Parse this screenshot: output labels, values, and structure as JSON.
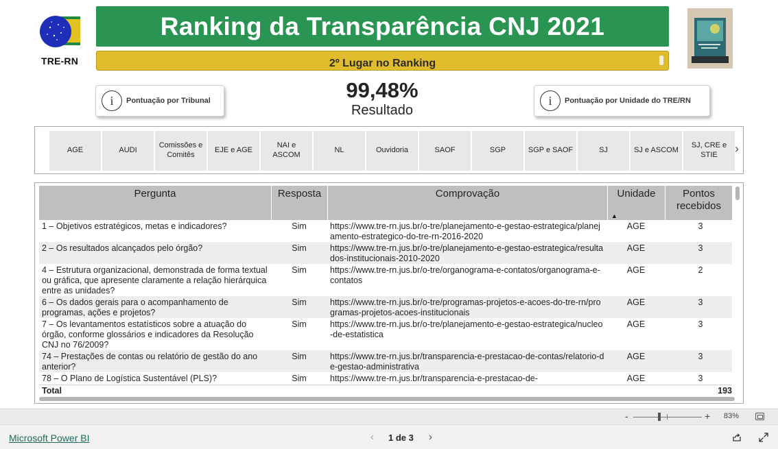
{
  "logo": {
    "text": "TRE-RN",
    "icon": "tre-rn-logo-icon"
  },
  "header": {
    "title": "Ranking da Transparência CNJ 2021",
    "subtitle": "2º Lugar no Ranking",
    "trophy_image": "trophy-image"
  },
  "buttons": {
    "tribunal": {
      "label": "Pontuação por Tribunal",
      "icon": "info-icon"
    },
    "unidade": {
      "label": "Pontuação por Unidade do TRE/RN",
      "icon": "info-icon"
    }
  },
  "kpi": {
    "value": "99,48%",
    "label": "Resultado"
  },
  "slicer": {
    "items": [
      "AGE",
      "AUDI",
      "Comissões e Comitês",
      "EJE e AGE",
      "NAI e ASCOM",
      "NL",
      "Ouvidoria",
      "SAOF",
      "SGP",
      "SGP e SAOF",
      "SJ",
      "SJ e ASCOM",
      "SJ, CRE e STIE"
    ],
    "next_icon": "chevron-right-icon"
  },
  "table": {
    "columns": [
      "Pergunta",
      "Resposta",
      "Comprovação",
      "Unidade",
      "Pontos recebidos"
    ],
    "sort_icon": "sort-ascending-icon",
    "rows": [
      {
        "pergunta": "1 – Objetivos estratégicos, metas e indicadores?",
        "resposta": "Sim",
        "comprovacao": "https://www.tre-rn.jus.br/o-tre/planejamento-e-gestao-estrategica/planejamento-estrategico-do-tre-rn-2016-2020",
        "unidade": "AGE",
        "pontos": "3"
      },
      {
        "pergunta": "2 – Os resultados alcançados pelo órgão?",
        "resposta": "Sim",
        "comprovacao": "https://www.tre-rn.jus.br/o-tre/planejamento-e-gestao-estrategica/resultados-institucionais-2010-2020",
        "unidade": "AGE",
        "pontos": "3"
      },
      {
        "pergunta": "4 – Estrutura organizacional, demonstrada de forma textual ou gráfica, que apresente claramente a relação hierárquica entre as unidades?",
        "resposta": "Sim",
        "comprovacao": "https://www.tre-rn.jus.br/o-tre/organograma-e-contatos/organograma-e-contatos",
        "unidade": "AGE",
        "pontos": "2"
      },
      {
        "pergunta": "6 – Os dados gerais para o acompanhamento de programas, ações e projetos?",
        "resposta": "Sim",
        "comprovacao": "https://www.tre-rn.jus.br/o-tre/programas-projetos-e-acoes-do-tre-rn/programas-projetos-acoes-institucionais",
        "unidade": "AGE",
        "pontos": "3"
      },
      {
        "pergunta": "7 – Os levantamentos estatísticos sobre a atuação do órgão, conforme glossários e indicadores da Resolução CNJ no 76/2009?",
        "resposta": "Sim",
        "comprovacao": "https://www.tre-rn.jus.br/o-tre/planejamento-e-gestao-estrategica/nucleo-de-estatistica",
        "unidade": "AGE",
        "pontos": "3"
      },
      {
        "pergunta": "74 – Prestações de contas ou relatório de gestão do ano anterior?",
        "resposta": "Sim",
        "comprovacao": "https://www.tre-rn.jus.br/transparencia-e-prestacao-de-contas/relatorio-de-gestao-administrativa",
        "unidade": "AGE",
        "pontos": "3"
      },
      {
        "pergunta": "78 – O Plano de Logística Sustentável (PLS)?",
        "resposta": "Sim",
        "comprovacao": "https://www.tre-rn.jus.br/transparencia-e-prestacao-de-",
        "unidade": "AGE",
        "pontos": "3"
      }
    ],
    "total_label": "Total",
    "total_value": "193"
  },
  "zoom": {
    "minus": "-",
    "plus": "+",
    "value": "83%",
    "level": 0.38,
    "fit_icon": "fit-to-page-icon"
  },
  "footer": {
    "link": "Microsoft Power BI",
    "page_indicator": "1 de 3",
    "prev_icon": "chevron-left-icon",
    "next_icon": "chevron-right-icon",
    "share_icon": "share-icon",
    "expand_icon": "expand-icon"
  },
  "colors": {
    "title_green": "#2a9453",
    "rank_yellow": "#e1bc2c",
    "header_gray": "#bfbfbf",
    "row_alt": "#eeeeee",
    "link_teal": "#1b6b5c"
  }
}
